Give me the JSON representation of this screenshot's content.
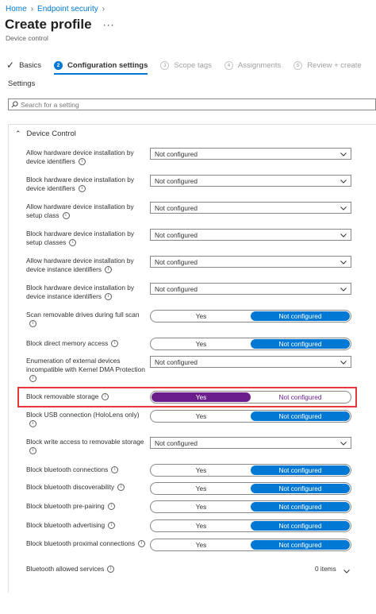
{
  "breadcrumb": [
    {
      "label": "Home"
    },
    {
      "label": "Endpoint security"
    }
  ],
  "header": {
    "title": "Create profile",
    "more_label": "···",
    "subtitle": "Device control"
  },
  "wizard": {
    "steps": [
      {
        "label": "Basics",
        "state": "done",
        "number": ""
      },
      {
        "label": "Configuration settings",
        "state": "active",
        "number": "2"
      },
      {
        "label": "Scope tags",
        "state": "pending",
        "number": "3"
      },
      {
        "label": "Assignments",
        "state": "pending",
        "number": "4"
      },
      {
        "label": "Review + create",
        "state": "pending",
        "number": "5"
      }
    ]
  },
  "settings_label": "Settings",
  "search": {
    "placeholder": "Search for a setting"
  },
  "section": {
    "title": "Device Control"
  },
  "rows": [
    {
      "label": "Allow hardware device installation by device identifiers",
      "type": "dropdown",
      "value": "Not configured"
    },
    {
      "label": "Block hardware device installation by device identifiers",
      "type": "dropdown",
      "value": "Not configured"
    },
    {
      "label": "Allow hardware device installation by setup class",
      "type": "dropdown",
      "value": "Not configured"
    },
    {
      "label": "Block hardware device installation by setup classes",
      "type": "dropdown",
      "value": "Not configured"
    },
    {
      "label": "Allow hardware device installation by device instance identifiers",
      "type": "dropdown",
      "value": "Not configured"
    },
    {
      "label": "Block hardware device installation by device instance identifiers",
      "type": "dropdown",
      "value": "Not configured"
    },
    {
      "label": "Scan removable drives during full scan",
      "type": "toggle",
      "options": [
        "Yes",
        "Not configured"
      ],
      "selected": "Not configured"
    },
    {
      "label": "Block direct memory access",
      "type": "toggle",
      "options": [
        "Yes",
        "Not configured"
      ],
      "selected": "Not configured"
    },
    {
      "label": "Enumeration of external devices incompatible with Kernel DMA Protection",
      "type": "dropdown",
      "value": "Not configured"
    },
    {
      "label": "Block removable storage",
      "type": "toggle",
      "options": [
        "Yes",
        "Not configured"
      ],
      "selected": "Yes",
      "highlighted": true
    },
    {
      "label": "Block USB connection (HoloLens only)",
      "type": "toggle",
      "options": [
        "Yes",
        "Not configured"
      ],
      "selected": "Not configured"
    },
    {
      "label": "Block write access to removable storage",
      "type": "dropdown",
      "value": "Not configured"
    },
    {
      "label": "Block bluetooth connections",
      "type": "toggle",
      "options": [
        "Yes",
        "Not configured"
      ],
      "selected": "Not configured"
    },
    {
      "label": "Block bluetooth discoverability",
      "type": "toggle",
      "options": [
        "Yes",
        "Not configured"
      ],
      "selected": "Not configured"
    },
    {
      "label": "Block bluetooth pre-pairing",
      "type": "toggle",
      "options": [
        "Yes",
        "Not configured"
      ],
      "selected": "Not configured"
    },
    {
      "label": "Block bluetooth advertising",
      "type": "toggle",
      "options": [
        "Yes",
        "Not configured"
      ],
      "selected": "Not configured"
    },
    {
      "label": "Block bluetooth proximal connections",
      "type": "toggle",
      "options": [
        "Yes",
        "Not configured"
      ],
      "selected": "Not configured"
    },
    {
      "label": "Bluetooth allowed services",
      "type": "list",
      "value": "0 items"
    }
  ],
  "colors": {
    "accent": "#0078d4",
    "selected_highlight": "#6b1d8c",
    "highlight_border": "#e5393b"
  },
  "icons": {
    "info": "info-icon",
    "search": "search-icon",
    "dropdown": "chevron-down-icon"
  }
}
